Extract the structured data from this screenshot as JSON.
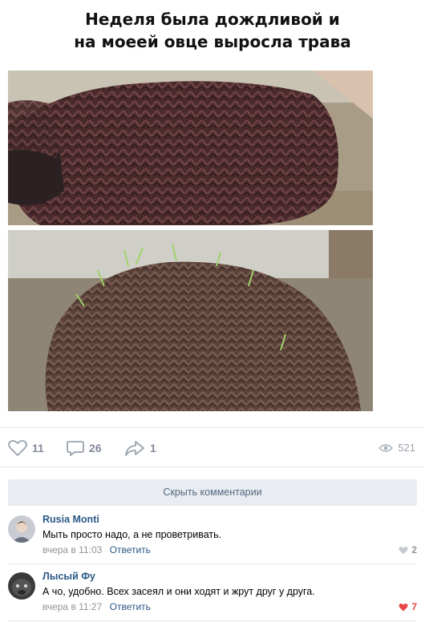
{
  "meme": {
    "title_line1": "Неделя была дождливой и",
    "title_line2": "на моеей овце выросла трава"
  },
  "post_actions": {
    "likes": "11",
    "comments": "26",
    "shares": "1",
    "views": "521"
  },
  "comments_toggle": "Скрыть комментарии",
  "comments": [
    {
      "author": "Rusia Monti",
      "text": "Мыть просто надо, а не проветривать.",
      "time": "вчера в 11:03",
      "reply": "Ответить",
      "likes": "2",
      "liked": false
    },
    {
      "author": "Лысый Фу",
      "text": "А чо, удобно. Всех засеял и они ходят и жрут друг у друга.",
      "time": "вчера в 11:27",
      "reply": "Ответить",
      "likes": "7",
      "liked": true
    }
  ],
  "colors": {
    "link": "#2a5885",
    "meta": "#939393",
    "liked": "#e64646",
    "button_bg": "#e9edf2"
  }
}
